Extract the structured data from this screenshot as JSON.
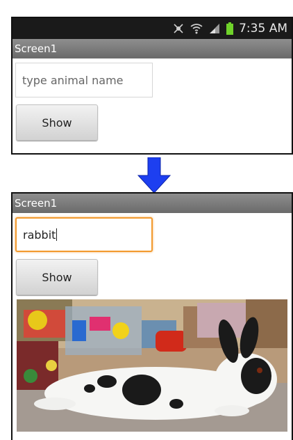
{
  "status_bar": {
    "time": "7:35 AM",
    "icons": [
      "mute-icon",
      "wifi-icon",
      "signal-icon",
      "battery-icon"
    ],
    "battery_color": "#6fd22a"
  },
  "before": {
    "title": "Screen1",
    "textbox_placeholder": "type animal name",
    "button_label": "Show"
  },
  "after": {
    "title": "Screen1",
    "textbox_value": "rabbit",
    "button_label": "Show",
    "image": "rabbit-photo"
  },
  "arrow": {
    "icon": "down-arrow-icon",
    "color": "#1d3ff0"
  },
  "colors": {
    "focus_border": "#f29a2e",
    "titlebar": "#7a7a7a",
    "statusbar": "#1a1a1a"
  }
}
